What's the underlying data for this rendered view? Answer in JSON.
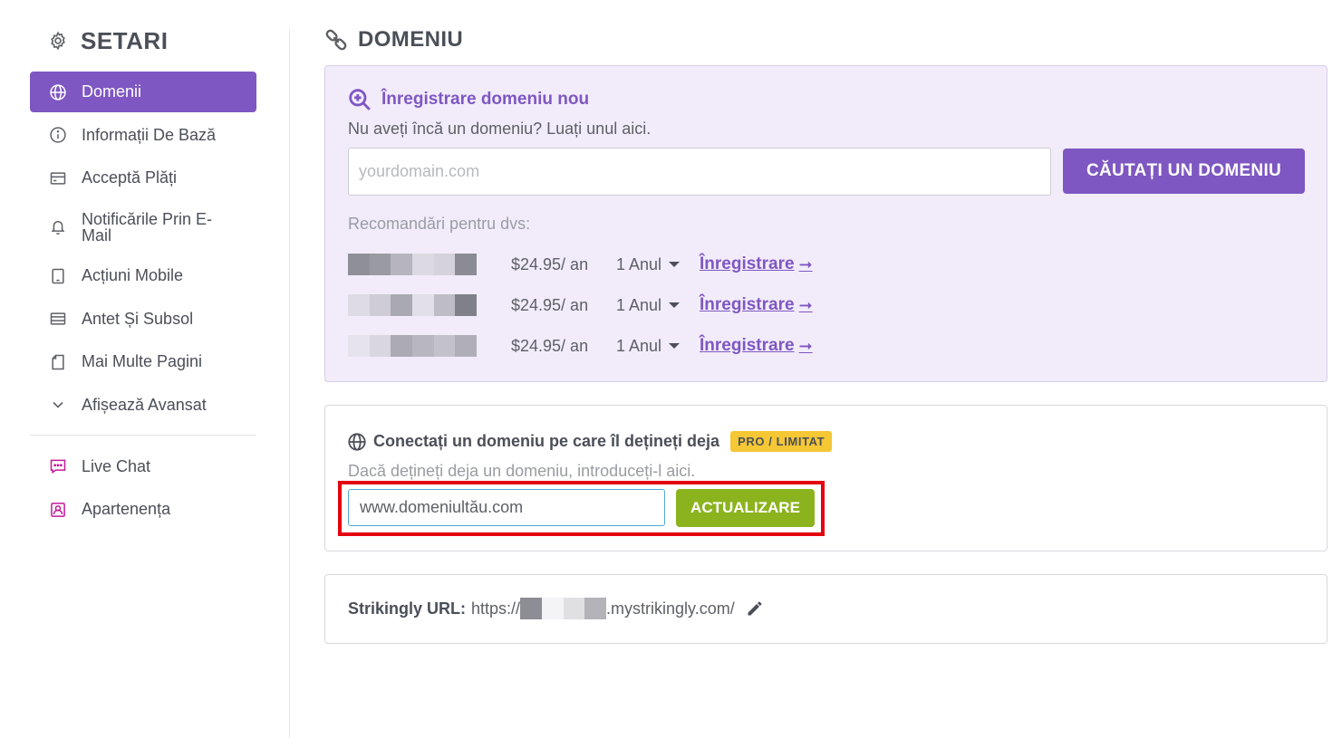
{
  "sidebar": {
    "title": "SETARI",
    "items": [
      {
        "label": "Domenii",
        "icon": "globe-icon",
        "active": true
      },
      {
        "label": "Informații De Bază",
        "icon": "info-icon"
      },
      {
        "label": "Acceptă Plăți",
        "icon": "card-icon"
      },
      {
        "label": "Notificările Prin E-Mail",
        "icon": "bell-icon"
      },
      {
        "label": "Acțiuni Mobile",
        "icon": "tablet-icon"
      },
      {
        "label": "Antet Și Subsol",
        "icon": "layout-icon"
      },
      {
        "label": "Mai Multe Pagini",
        "icon": "pages-icon"
      },
      {
        "label": "Afișează Avansat",
        "icon": "chevron-down-icon"
      }
    ],
    "extra": [
      {
        "label": "Live Chat",
        "icon": "chat-icon"
      },
      {
        "label": "Apartenența",
        "icon": "member-icon"
      }
    ]
  },
  "main": {
    "title": "DOMENIU",
    "register": {
      "heading": "Înregistrare domeniu nou",
      "subtitle": "Nu aveți încă un domeniu? Luați unul aici.",
      "input_placeholder": "yourdomain.com",
      "search_button": "CĂUTAȚI UN DOMENIU",
      "recommend_label": "Recomandări pentru dvs:",
      "rows": [
        {
          "price": "$24.95/ an",
          "period": "1 Anul",
          "link": "Înregistrare"
        },
        {
          "price": "$24.95/ an",
          "period": "1 Anul",
          "link": "Înregistrare"
        },
        {
          "price": "$24.95/ an",
          "period": "1 Anul",
          "link": "Înregistrare"
        }
      ]
    },
    "connect": {
      "heading": "Conectați un domeniu pe care îl dețineți deja",
      "badge": "PRO / LIMITAT",
      "subtitle": "Dacă dețineți deja un domeniu, introduceți-l aici.",
      "input_value": "www.domeniultău.com",
      "update_button": "ACTUALIZARE"
    },
    "url": {
      "label": "Strikingly URL:",
      "prefix": "https://",
      "suffix": ".mystrikingly.com/"
    }
  },
  "colors": {
    "accent": "#7e57c2",
    "update_green": "#8bb31e",
    "badge_yellow": "#f5c735",
    "highlight_red": "#e3000f",
    "magenta_icons": "#c2189b"
  }
}
